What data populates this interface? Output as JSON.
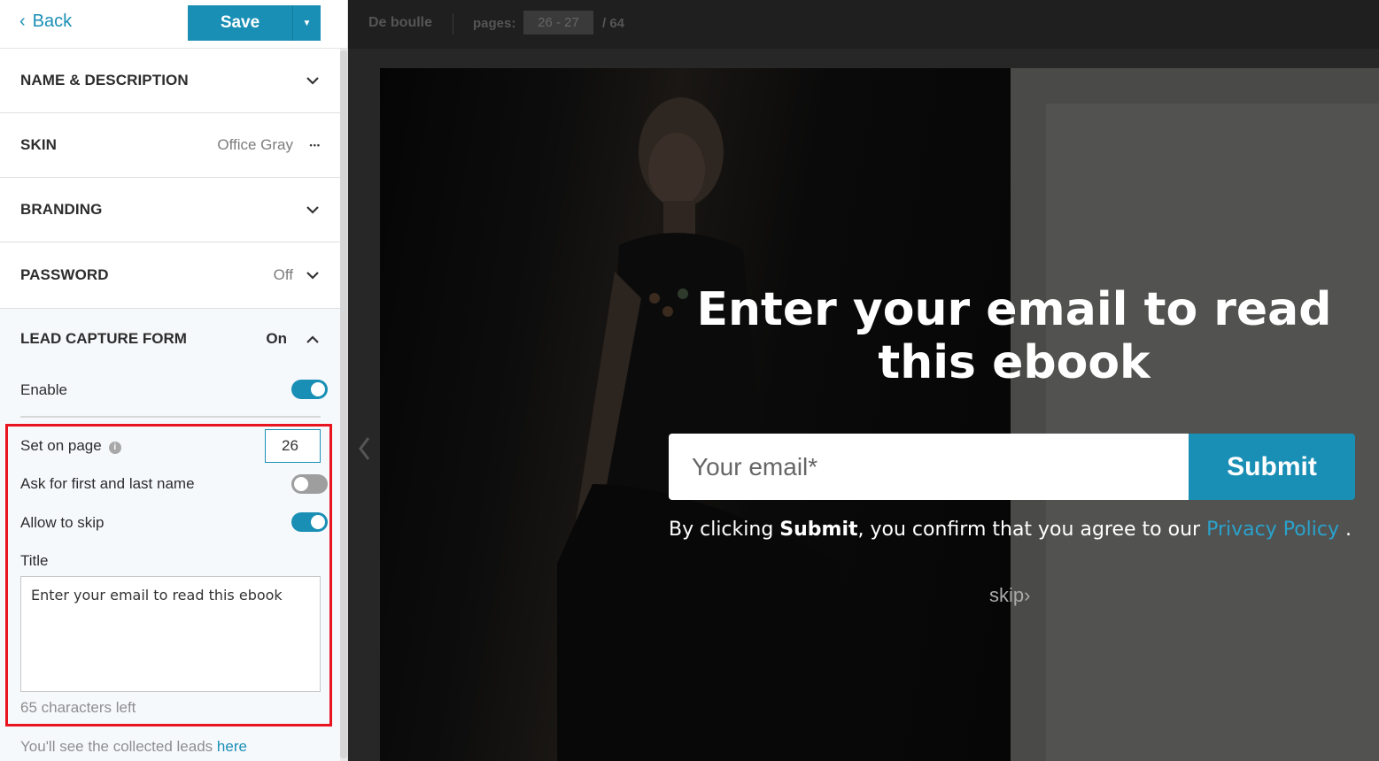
{
  "sidebar": {
    "back_label": "Back",
    "save_label": "Save",
    "sections": {
      "name_desc": "NAME & DESCRIPTION",
      "skin": "SKIN",
      "skin_value": "Office Gray",
      "skin_more": "•••",
      "branding": "BRANDING",
      "password": "PASSWORD",
      "password_value": "Off"
    },
    "lead_capture": {
      "title": "LEAD CAPTURE FORM",
      "status": "On",
      "enable_label": "Enable",
      "enable_on": true,
      "set_on_page_label": "Set on page",
      "set_on_page_value": "26",
      "info_icon": "i",
      "ask_name_label": "Ask for first and last name",
      "ask_name_on": false,
      "allow_skip_label": "Allow to skip",
      "allow_skip_on": true,
      "title_label": "Title",
      "title_value": "Enter your email to read this ebook",
      "chars_left": "65 characters left",
      "leads_note": "You'll see the collected leads",
      "leads_link": "here"
    }
  },
  "preview": {
    "doc_name": "De boulle",
    "pages_label": "pages:",
    "pages_range": "26 - 27",
    "pages_total": "/  64",
    "overlay": {
      "title": "Enter your email to read this ebook",
      "email_placeholder": "Your email*",
      "submit_label": "Submit",
      "consent_prefix": "By clicking ",
      "consent_bold": "Submit",
      "consent_middle": ", you confirm that you agree to our ",
      "consent_link": "Privacy Policy",
      "consent_suffix": " .",
      "skip_label": "skip›"
    }
  },
  "colors": {
    "accent": "#1a8fb5",
    "highlight_border": "#e8141f",
    "toggle_off": "#9e9e9e"
  }
}
